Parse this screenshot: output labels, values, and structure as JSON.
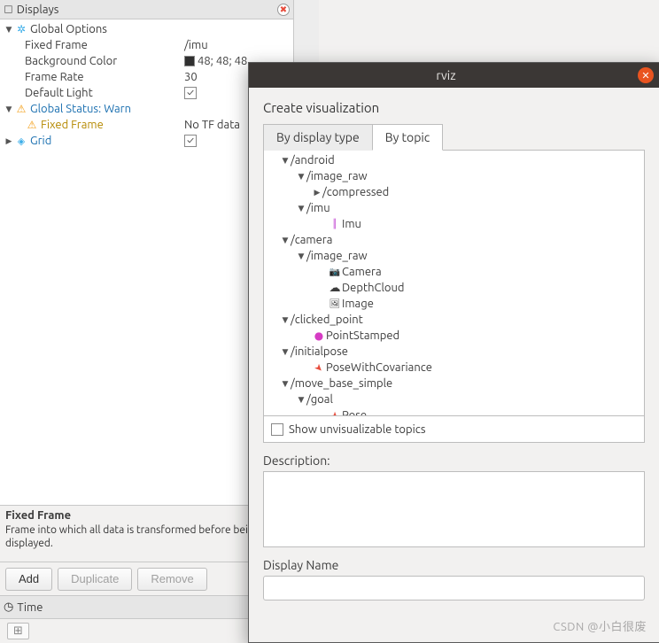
{
  "left_panel": {
    "title": "Displays",
    "global_options": {
      "label": "Global Options",
      "fixed_frame": {
        "label": "Fixed Frame",
        "value": "/imu"
      },
      "background_color": {
        "label": "Background Color",
        "value": "48; 48; 48"
      },
      "frame_rate": {
        "label": "Frame Rate",
        "value": "30"
      },
      "default_light": {
        "label": "Default Light",
        "checked": true
      }
    },
    "global_status": {
      "label": "Global Status: Warn",
      "fixed_frame": {
        "label": "Fixed Frame",
        "value": "No TF data"
      }
    },
    "grid": {
      "label": "Grid",
      "checked": true
    },
    "help": {
      "title": "Fixed Frame",
      "body": "Frame into which all data is transformed before being displayed."
    },
    "buttons": {
      "add": "Add",
      "duplicate": "Duplicate",
      "remove": "Remove"
    },
    "time_label": "Time"
  },
  "dialog": {
    "title": "rviz",
    "heading": "Create visualization",
    "tabs": {
      "by_display_type": "By display type",
      "by_topic": "By topic"
    },
    "tree": {
      "android": {
        "label": "/android",
        "image_raw": {
          "label": "/image_raw",
          "compressed": "/compressed"
        },
        "imu": {
          "label": "/imu",
          "type": "Imu"
        }
      },
      "camera": {
        "label": "/camera",
        "image_raw": {
          "label": "/image_raw",
          "camera": "Camera",
          "depthcloud": "DepthCloud",
          "image": "Image"
        }
      },
      "clicked_point": {
        "label": "/clicked_point",
        "type": "PointStamped"
      },
      "initialpose": {
        "label": "/initialpose",
        "type": "PoseWithCovariance"
      },
      "move_base_simple": {
        "label": "/move_base_simple",
        "goal": {
          "label": "/goal",
          "type": "Pose"
        }
      }
    },
    "show_unvisualizable": "Show unvisualizable topics",
    "description_label": "Description:",
    "display_name_label": "Display Name",
    "display_name_value": ""
  },
  "watermark": "CSDN @小白很废"
}
